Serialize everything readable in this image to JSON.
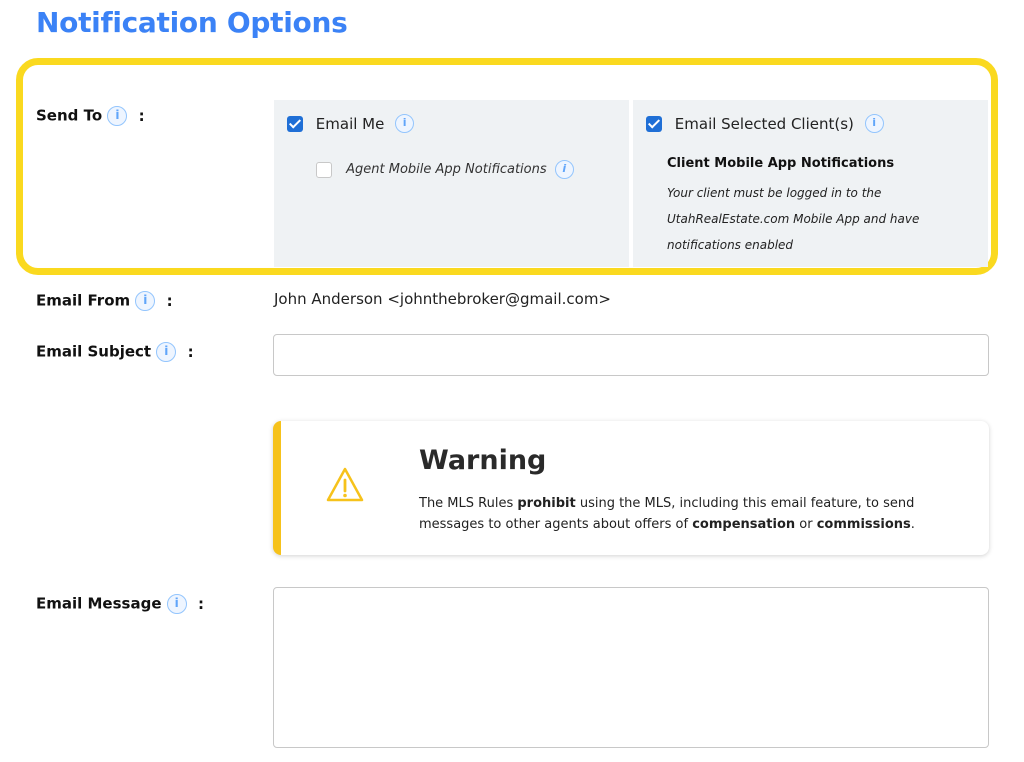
{
  "section_title": "Notification Options",
  "info_glyph": "i",
  "send_to": {
    "label": "Send To",
    "colon": ":",
    "email_me": {
      "label": "Email Me",
      "checked": true
    },
    "agent_app": {
      "label": "Agent Mobile App Notifications",
      "checked": false
    },
    "email_clients": {
      "label": "Email Selected Client(s)",
      "checked": true
    },
    "client_app_heading": "Client Mobile App Notifications",
    "client_app_note": "Your client must be logged in to the UtahRealEstate.com Mobile App and have notifications enabled"
  },
  "email_from": {
    "label": "Email From",
    "colon": ":",
    "value": "John Anderson <johnthebroker@gmail.com>"
  },
  "email_subject": {
    "label": "Email Subject",
    "colon": ":",
    "value": ""
  },
  "warning": {
    "title": "Warning",
    "text_1": "The MLS Rules ",
    "bold_1": "prohibit",
    "text_2": " using the MLS, including this email feature, to send messages to other agents about offers of ",
    "bold_2": "compensation",
    "text_3": " or ",
    "bold_3": "commissions",
    "text_4": ".",
    "icon": "warning-triangle-icon",
    "accent_color": "#f6c21b"
  },
  "email_message": {
    "label": "Email Message",
    "colon": ":",
    "value": ""
  },
  "colors": {
    "title": "#3b82f6",
    "highlight_border": "#fad91f",
    "checkbox": "#1f6fd6",
    "panel_bg": "#eff2f4"
  }
}
